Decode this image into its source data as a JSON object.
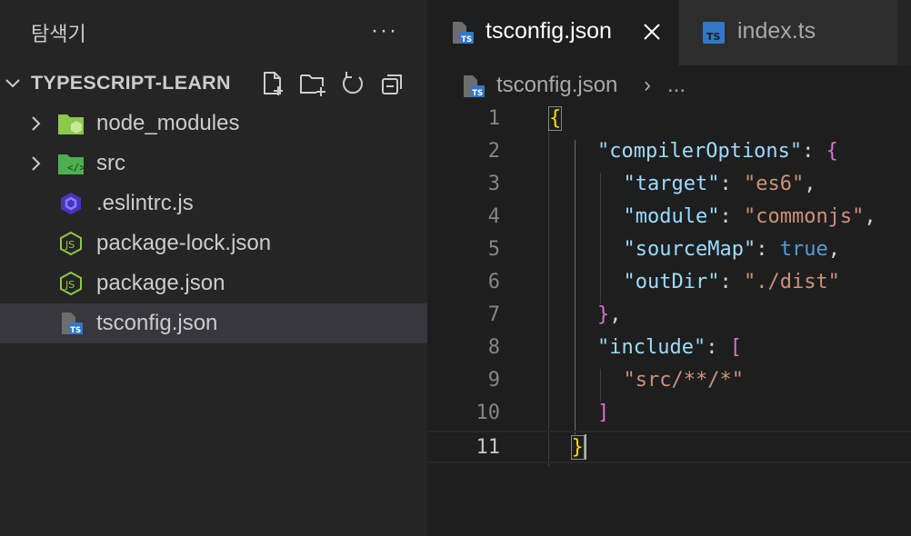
{
  "explorer": {
    "title": "탐색기",
    "more_label": "···",
    "project": {
      "name": "TYPESCRIPT-LEARN",
      "actions": [
        "new-file-icon",
        "new-folder-icon",
        "refresh-icon",
        "collapse-all-icon"
      ]
    },
    "items": [
      {
        "label": "node_modules",
        "kind": "folder",
        "icon": "node-folder-icon",
        "collapsed": true
      },
      {
        "label": "src",
        "kind": "folder",
        "icon": "src-folder-icon",
        "collapsed": true
      },
      {
        "label": ".eslintrc.js",
        "kind": "file",
        "icon": "eslint-icon"
      },
      {
        "label": "package-lock.json",
        "kind": "file",
        "icon": "nodejs-icon"
      },
      {
        "label": "package.json",
        "kind": "file",
        "icon": "nodejs-icon"
      },
      {
        "label": "tsconfig.json",
        "kind": "file",
        "icon": "tsconfig-icon",
        "selected": true
      }
    ]
  },
  "editor": {
    "tabs": [
      {
        "label": "tsconfig.json",
        "active": true,
        "icon": "tsconfig-icon",
        "close_icon": "close-icon"
      },
      {
        "label": "index.ts",
        "active": false,
        "icon": "typescript-icon"
      }
    ],
    "breadcrumb": {
      "file": "tsconfig.json",
      "separator": "›",
      "more": "..."
    },
    "current_line": 11,
    "lines": [
      {
        "n": "1",
        "indent": 0,
        "tokens": [
          [
            "{",
            "brace-y"
          ]
        ]
      },
      {
        "n": "2",
        "indent": 2,
        "tokens": [
          [
            "\"compilerOptions\"",
            "key"
          ],
          [
            ": ",
            "punc"
          ],
          [
            "{",
            "brace-p"
          ]
        ]
      },
      {
        "n": "3",
        "indent": 3,
        "tokens": [
          [
            "\"target\"",
            "key"
          ],
          [
            ": ",
            "punc"
          ],
          [
            "\"es6\"",
            "str"
          ],
          [
            ",",
            "punc"
          ]
        ]
      },
      {
        "n": "4",
        "indent": 3,
        "tokens": [
          [
            "\"module\"",
            "key"
          ],
          [
            ": ",
            "punc"
          ],
          [
            "\"commonjs\"",
            "str"
          ],
          [
            ",",
            "punc"
          ]
        ]
      },
      {
        "n": "5",
        "indent": 3,
        "tokens": [
          [
            "\"sourceMap\"",
            "key"
          ],
          [
            ": ",
            "punc"
          ],
          [
            "true",
            "bool"
          ],
          [
            ",",
            "punc"
          ]
        ]
      },
      {
        "n": "6",
        "indent": 3,
        "tokens": [
          [
            "\"outDir\"",
            "key"
          ],
          [
            ": ",
            "punc"
          ],
          [
            "\"./dist\"",
            "str"
          ]
        ]
      },
      {
        "n": "7",
        "indent": 2,
        "tokens": [
          [
            "}",
            "brace-p"
          ],
          [
            ",",
            "punc"
          ]
        ]
      },
      {
        "n": "8",
        "indent": 2,
        "tokens": [
          [
            "\"include\"",
            "key"
          ],
          [
            ": ",
            "punc"
          ],
          [
            "[",
            "brace-p"
          ]
        ]
      },
      {
        "n": "9",
        "indent": 3,
        "tokens": [
          [
            "\"src/**/*\"",
            "str"
          ]
        ]
      },
      {
        "n": "10",
        "indent": 2,
        "tokens": [
          [
            "]",
            "brace-p"
          ]
        ]
      },
      {
        "n": "11",
        "indent": 1,
        "tokens": [
          [
            "}",
            "brace-y"
          ]
        ]
      }
    ]
  },
  "colors": {
    "sidebar_bg": "#252526",
    "editor_bg": "#1e1e1e",
    "selection_bg": "#37373d",
    "json_key": "#9cdcfe",
    "json_string": "#ce9178",
    "json_bool": "#569cd6",
    "bracket_gold": "#ffd700",
    "bracket_orchid": "#da70d6",
    "ts_blue": "#3178c6",
    "node_green": "#8cc84b"
  }
}
